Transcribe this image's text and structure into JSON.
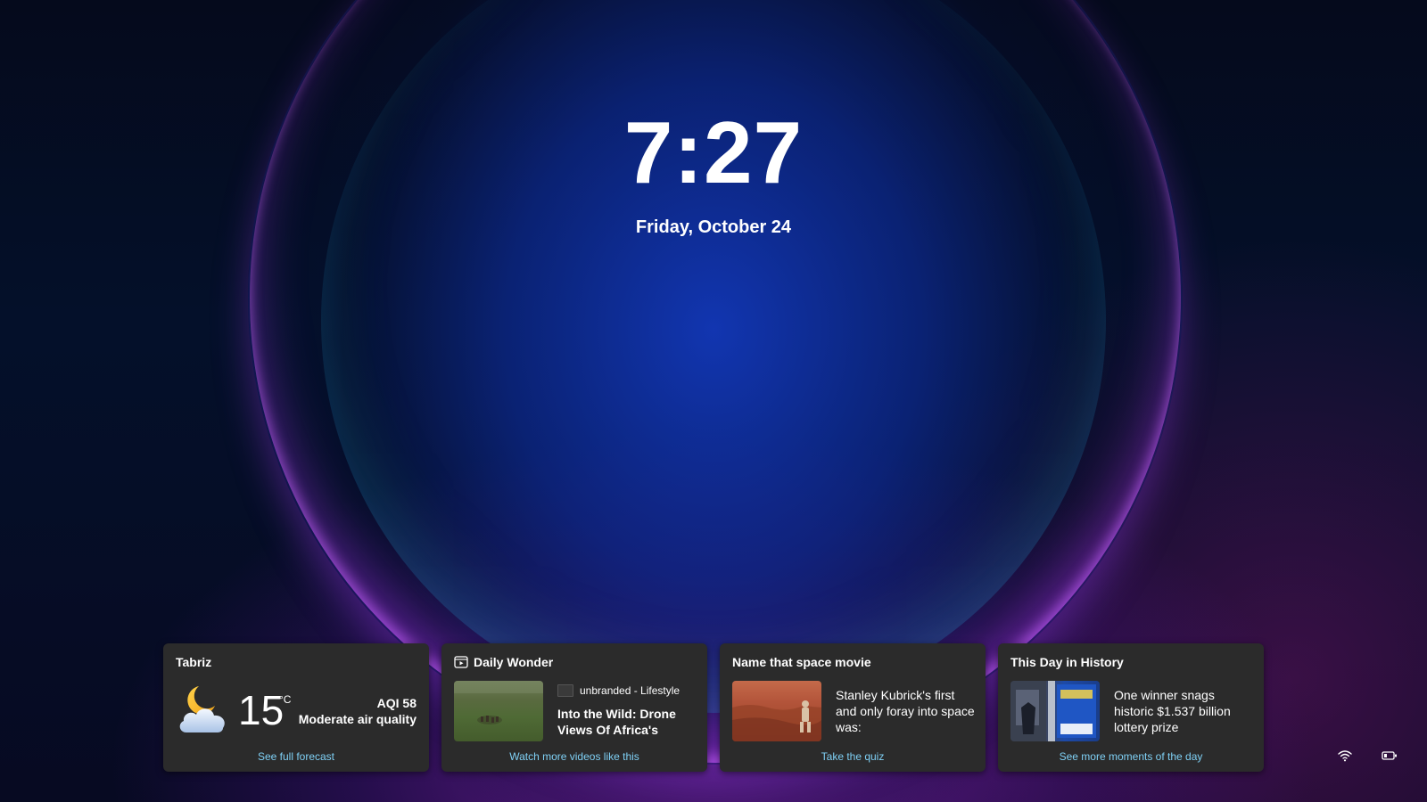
{
  "lock_screen": {
    "time": "7:27",
    "date": "Friday, October 24"
  },
  "widgets": {
    "weather": {
      "title": "Tabriz",
      "temperature": "15",
      "unit": "°C",
      "aqi": "AQI 58",
      "air_quality": "Moderate air quality",
      "link": "See full forecast",
      "icon": "partly-cloudy-night-icon"
    },
    "daily_wonder": {
      "title": "Daily Wonder",
      "source": "unbranded - Lifestyle",
      "headline": "Into the Wild: Drone Views Of Africa's Stun...",
      "link": "Watch more videos like this",
      "icon": "video-icon"
    },
    "quiz": {
      "title": "Name that space movie",
      "text": "Stanley Kubrick's first and only foray into space was:",
      "link": "Take the quiz"
    },
    "history": {
      "title": "This Day in History",
      "text": "One winner snags historic $1.537 billion lottery prize",
      "link": "See more moments of the day"
    }
  },
  "system_tray": {
    "icons": [
      "wifi-icon",
      "battery-icon"
    ]
  },
  "colors": {
    "card_background": "#2b2b2b",
    "link": "#7fd0f5"
  }
}
